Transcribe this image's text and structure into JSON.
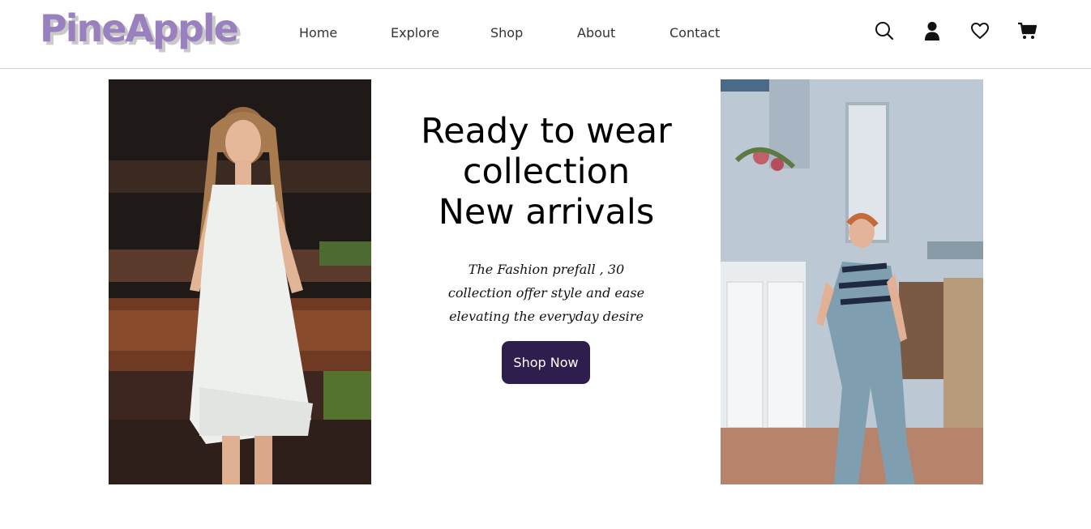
{
  "brand": {
    "logo_text": "PineApple",
    "logo_color": "#9a80bf"
  },
  "nav": {
    "links": [
      "Home",
      "Explore",
      "Shop",
      "About",
      "Contact"
    ],
    "icons": [
      "search-icon",
      "user-icon",
      "heart-icon",
      "cart-icon"
    ]
  },
  "hero": {
    "title_lines": [
      "Ready to wear",
      "collection",
      "New arrivals"
    ],
    "subtitle_lines": [
      "The Fashion prefall , 30",
      "collection offer style and ease",
      "elevating the everyday desire"
    ],
    "cta_label": "Shop Now",
    "cta_color": "#2e1e4e"
  },
  "images": {
    "left": "woman-in-white-dress-photo",
    "right": "woman-in-denim-jumpsuit-photo"
  }
}
